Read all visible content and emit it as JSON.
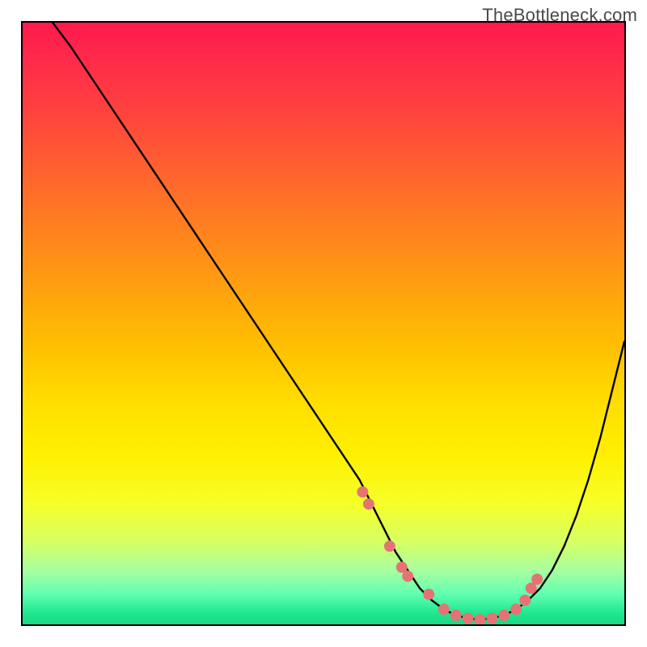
{
  "watermark": "TheBottleneck.com",
  "chart_data": {
    "type": "line",
    "title": "",
    "xlabel": "",
    "ylabel": "",
    "xlim": [
      0,
      100
    ],
    "ylim": [
      0,
      100
    ],
    "grid": false,
    "legend": false,
    "curve": {
      "x": [
        5,
        8,
        12,
        16,
        20,
        24,
        28,
        32,
        36,
        40,
        44,
        48,
        52,
        56,
        60,
        62,
        64,
        66,
        68,
        70,
        72,
        74,
        76,
        78,
        80,
        82,
        84,
        86,
        88,
        90,
        92,
        94,
        96,
        98,
        100
      ],
      "y": [
        100,
        96,
        90,
        84,
        78,
        72,
        66,
        60,
        54,
        48,
        42,
        36,
        30,
        24,
        16,
        12,
        9,
        6,
        4,
        2.5,
        1.5,
        1,
        0.8,
        1,
        1.5,
        2.5,
        4,
        6,
        9,
        13,
        18,
        24,
        31,
        39,
        47
      ],
      "color": "#000000",
      "width": 2.4
    },
    "points": {
      "x": [
        56.5,
        57.5,
        61,
        63,
        64,
        67.5,
        70,
        72,
        74,
        76,
        78,
        80,
        82,
        83.5,
        84.5,
        85.5
      ],
      "y": [
        22,
        20,
        13,
        9.5,
        8,
        5,
        2.5,
        1.5,
        1,
        0.8,
        1,
        1.5,
        2.5,
        4,
        6,
        7.5
      ],
      "color": "#e57373",
      "radius": 7
    }
  }
}
